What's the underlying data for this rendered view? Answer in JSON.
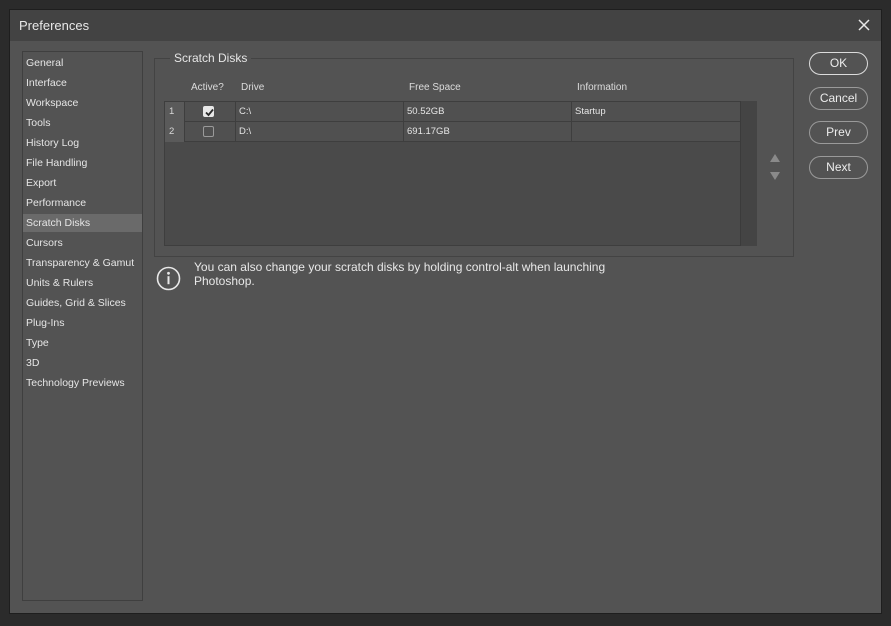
{
  "window": {
    "title": "Preferences"
  },
  "sidebar": {
    "items": [
      {
        "label": "General"
      },
      {
        "label": "Interface"
      },
      {
        "label": "Workspace"
      },
      {
        "label": "Tools"
      },
      {
        "label": "History Log"
      },
      {
        "label": "File Handling"
      },
      {
        "label": "Export"
      },
      {
        "label": "Performance"
      },
      {
        "label": "Scratch Disks",
        "selected": true
      },
      {
        "label": "Cursors"
      },
      {
        "label": "Transparency & Gamut"
      },
      {
        "label": "Units & Rulers"
      },
      {
        "label": "Guides, Grid & Slices"
      },
      {
        "label": "Plug-Ins"
      },
      {
        "label": "Type"
      },
      {
        "label": "3D"
      },
      {
        "label": "Technology Previews"
      }
    ]
  },
  "scratch": {
    "group_title": "Scratch Disks",
    "columns": {
      "active": "Active?",
      "drive": "Drive",
      "free": "Free Space",
      "info": "Information"
    },
    "rows": [
      {
        "num": "1",
        "active": true,
        "drive": "C:\\",
        "free": "50.52GB",
        "info": "Startup"
      },
      {
        "num": "2",
        "active": false,
        "drive": "D:\\",
        "free": "691.17GB",
        "info": ""
      }
    ],
    "info_text": "You can also change your scratch disks by holding control-alt when launching Photoshop."
  },
  "buttons": {
    "ok": "OK",
    "cancel": "Cancel",
    "prev": "Prev",
    "next": "Next"
  },
  "icons": {
    "close": "close-icon",
    "info": "info-icon",
    "up": "arrow-up-icon",
    "down": "arrow-down-icon",
    "check": "checkmark-icon"
  },
  "colors": {
    "dialog_bg": "#535353",
    "titlebar_bg": "#434343",
    "selected_item": "#6a6a6a",
    "text": "#e6e6e6"
  }
}
